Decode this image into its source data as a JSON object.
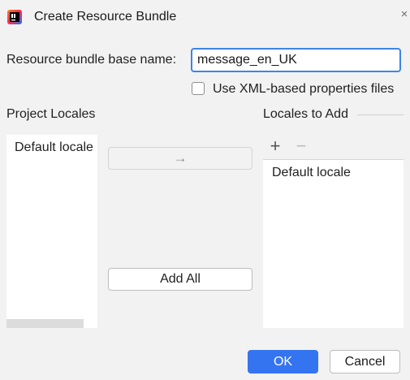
{
  "dialog": {
    "title": "Create Resource Bundle",
    "app_icon": "intellij-idea-icon",
    "close_icon": "close-icon"
  },
  "form": {
    "base_name_label": "Resource bundle base name:",
    "base_name_value": "message_en_UK",
    "xml_checkbox_label": "Use XML-based properties files",
    "xml_checkbox_checked": false
  },
  "project_locales": {
    "header": "Project Locales",
    "items": [
      "Default locale"
    ]
  },
  "transfer": {
    "move_right_glyph": "→",
    "add_all_label": "Add All"
  },
  "locales_to_add": {
    "header": "Locales to Add",
    "add_glyph": "+",
    "remove_glyph": "−",
    "items": [
      "Default locale"
    ]
  },
  "footer": {
    "ok_label": "OK",
    "cancel_label": "Cancel"
  },
  "colors": {
    "accent": "#3574f0",
    "focus_border": "#3d84e6",
    "background": "#f2f2f2"
  }
}
